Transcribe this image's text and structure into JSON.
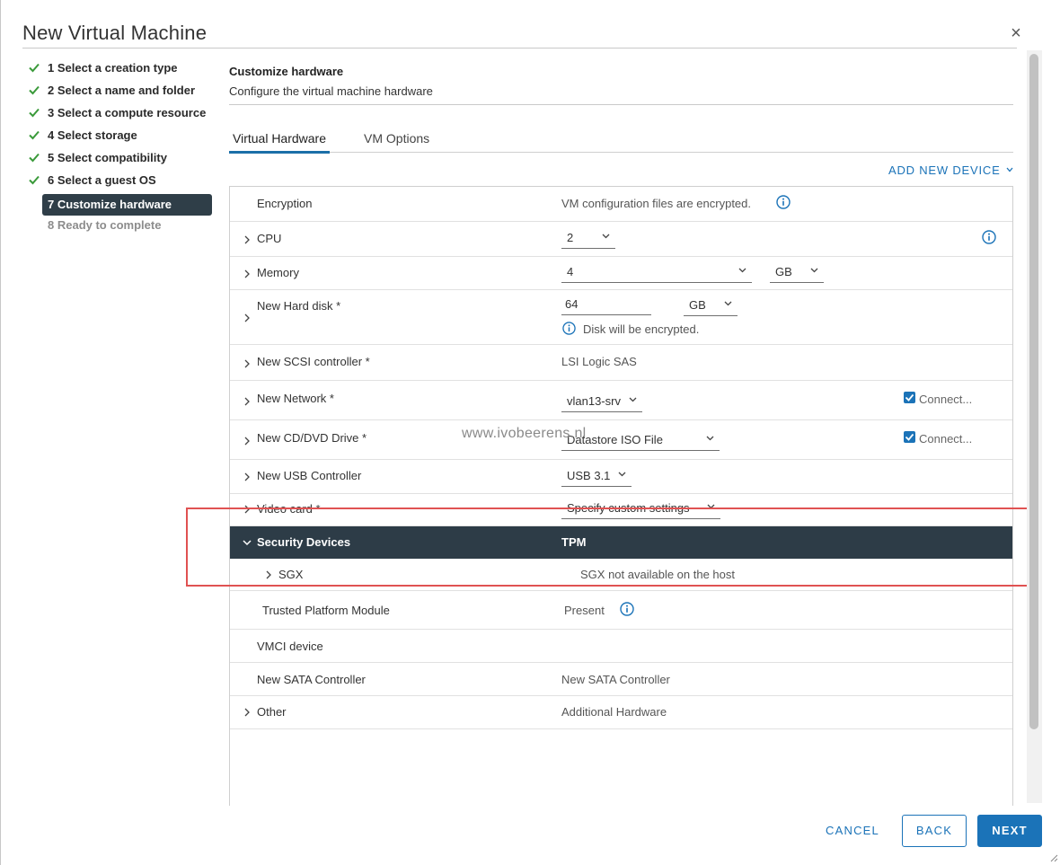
{
  "dialog": {
    "title": "New Virtual Machine"
  },
  "steps": [
    {
      "label": "1 Select a creation type",
      "state": "done"
    },
    {
      "label": "2 Select a name and folder",
      "state": "done"
    },
    {
      "label": "3 Select a compute resource",
      "state": "done"
    },
    {
      "label": "4 Select storage",
      "state": "done"
    },
    {
      "label": "5 Select compatibility",
      "state": "done"
    },
    {
      "label": "6 Select a guest OS",
      "state": "done"
    },
    {
      "label": "7 Customize hardware",
      "state": "active"
    },
    {
      "label": "8 Ready to complete",
      "state": "disabled"
    }
  ],
  "section": {
    "title": "Customize hardware",
    "subtitle": "Configure the virtual machine hardware"
  },
  "tabs": [
    {
      "label": "Virtual Hardware"
    },
    {
      "label": "VM Options"
    }
  ],
  "add_device": "ADD NEW DEVICE",
  "hardware": {
    "encryption": {
      "label": "Encryption",
      "value": "VM configuration files are encrypted."
    },
    "cpu": {
      "label": "CPU",
      "value": "2"
    },
    "memory": {
      "label": "Memory",
      "value": "4",
      "unit": "GB"
    },
    "hard_disk": {
      "label": "New Hard disk *",
      "value": "64",
      "unit": "GB",
      "note": "Disk will be encrypted."
    },
    "scsi": {
      "label": "New SCSI controller *",
      "value": "LSI Logic SAS"
    },
    "network": {
      "label": "New Network *",
      "value": "vlan13-srv",
      "connect": "Connect..."
    },
    "cdrom": {
      "label": "New CD/DVD Drive *",
      "value": "Datastore ISO File",
      "connect": "Connect..."
    },
    "usb": {
      "label": "New USB Controller",
      "value": "USB 3.1"
    },
    "video": {
      "label": "Video card *",
      "value": "Specify custom settings"
    },
    "security": {
      "label": "Security Devices",
      "value": "TPM"
    },
    "sgx": {
      "label": "SGX",
      "value": "SGX not available on the host"
    },
    "tpm": {
      "label": "Trusted Platform Module",
      "value": "Present"
    },
    "vmci": {
      "label": "VMCI device"
    },
    "sata": {
      "label": "New SATA Controller",
      "value": "New SATA Controller"
    },
    "other": {
      "label": "Other",
      "value": "Additional Hardware"
    }
  },
  "watermark": "www.ivobeerens.nl",
  "buttons": {
    "cancel": "CANCEL",
    "back": "BACK",
    "next": "NEXT"
  },
  "colors": {
    "accent": "#1b73b8",
    "header_dark": "#2d3c47",
    "highlight": "#e05252",
    "check": "#3a9a3a"
  }
}
